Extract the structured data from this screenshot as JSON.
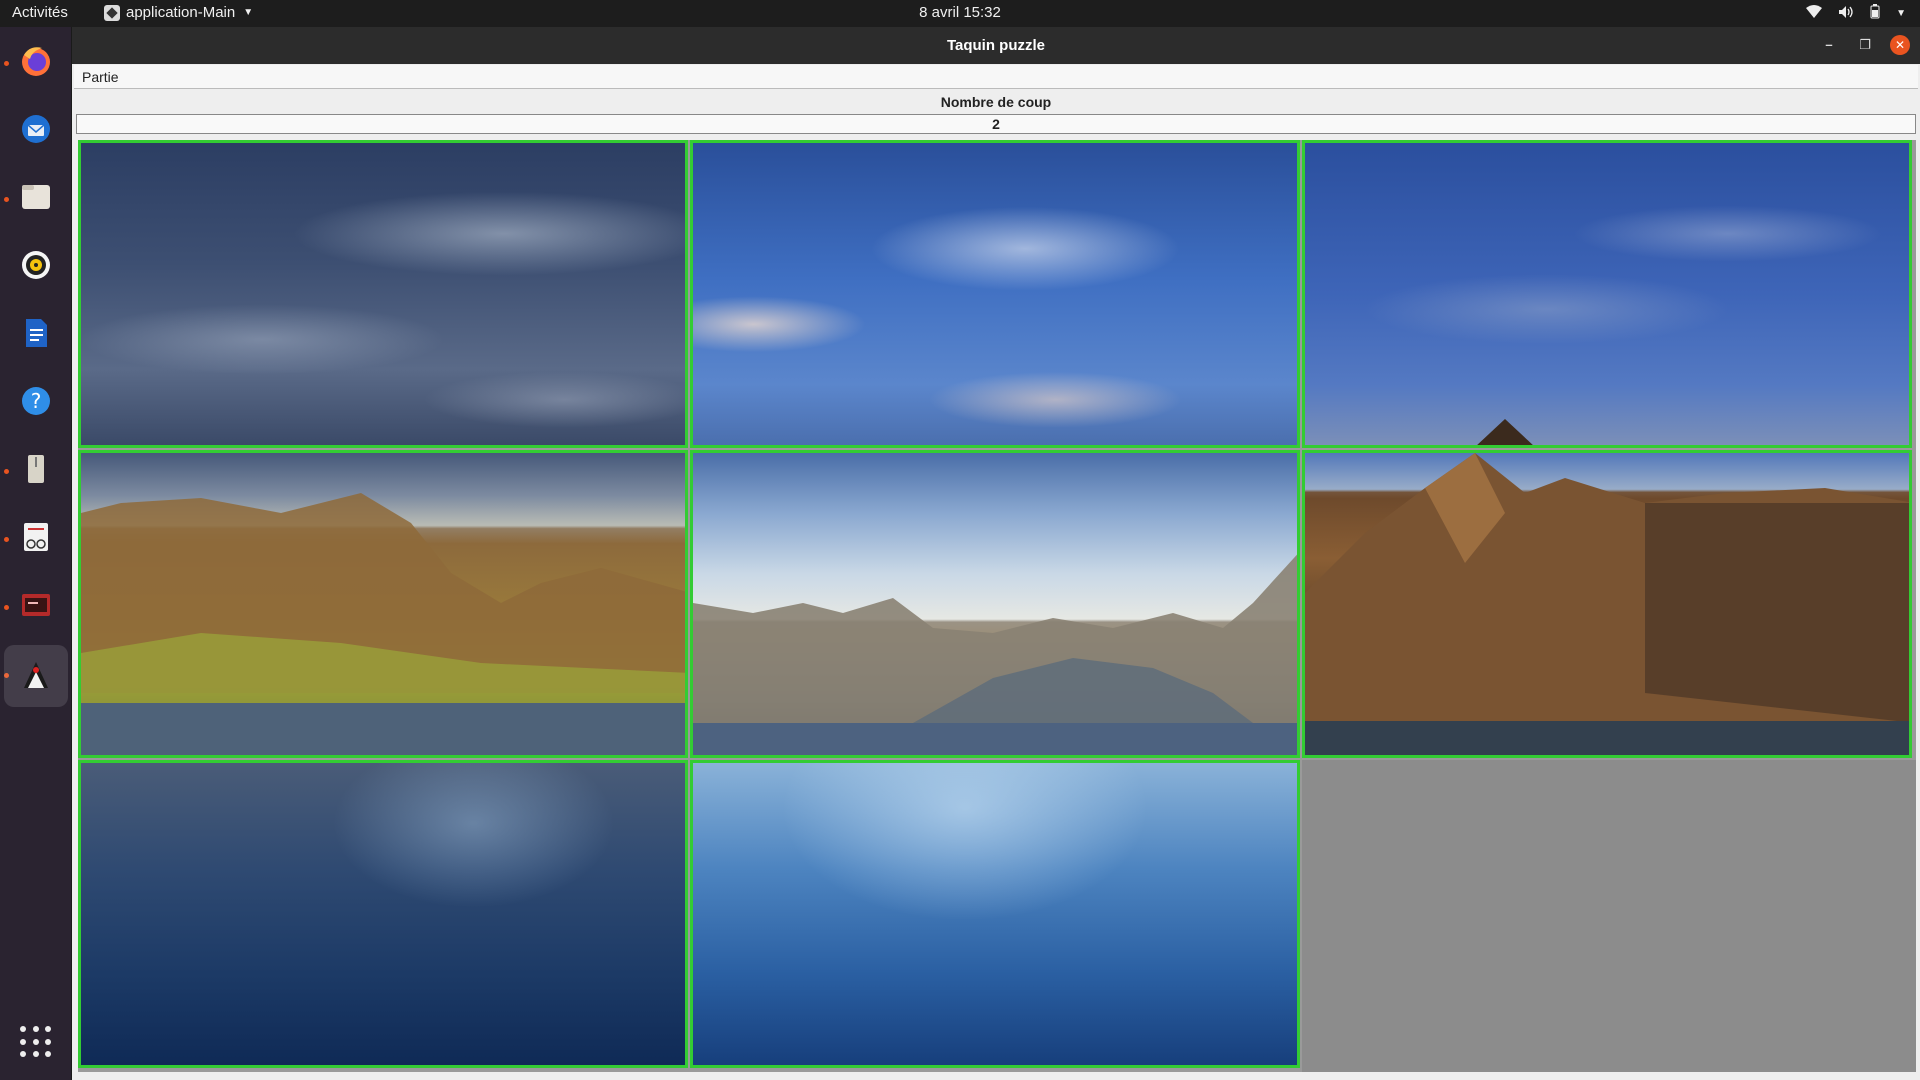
{
  "topbar": {
    "activities": "Activités",
    "app_menu": "application-Main",
    "clock": "8 avril  15:32"
  },
  "window": {
    "title": "Taquin puzzle",
    "menu": [
      "Partie"
    ],
    "counter_label": "Nombre de coup",
    "counter_value": "2"
  },
  "dock": {
    "items": [
      {
        "name": "firefox",
        "running": true
      },
      {
        "name": "thunderbird",
        "running": false
      },
      {
        "name": "files",
        "running": true
      },
      {
        "name": "rhythmbox",
        "running": false
      },
      {
        "name": "libreoffice-writer",
        "running": false
      },
      {
        "name": "help",
        "running": false
      },
      {
        "name": "archive",
        "running": true
      },
      {
        "name": "document-viewer",
        "running": true
      },
      {
        "name": "terminal-app",
        "running": true
      },
      {
        "name": "java-app",
        "running": true
      }
    ]
  },
  "board": {
    "rows": 3,
    "cols": 3,
    "empty_index": 8,
    "border_color": "#33cc33"
  }
}
